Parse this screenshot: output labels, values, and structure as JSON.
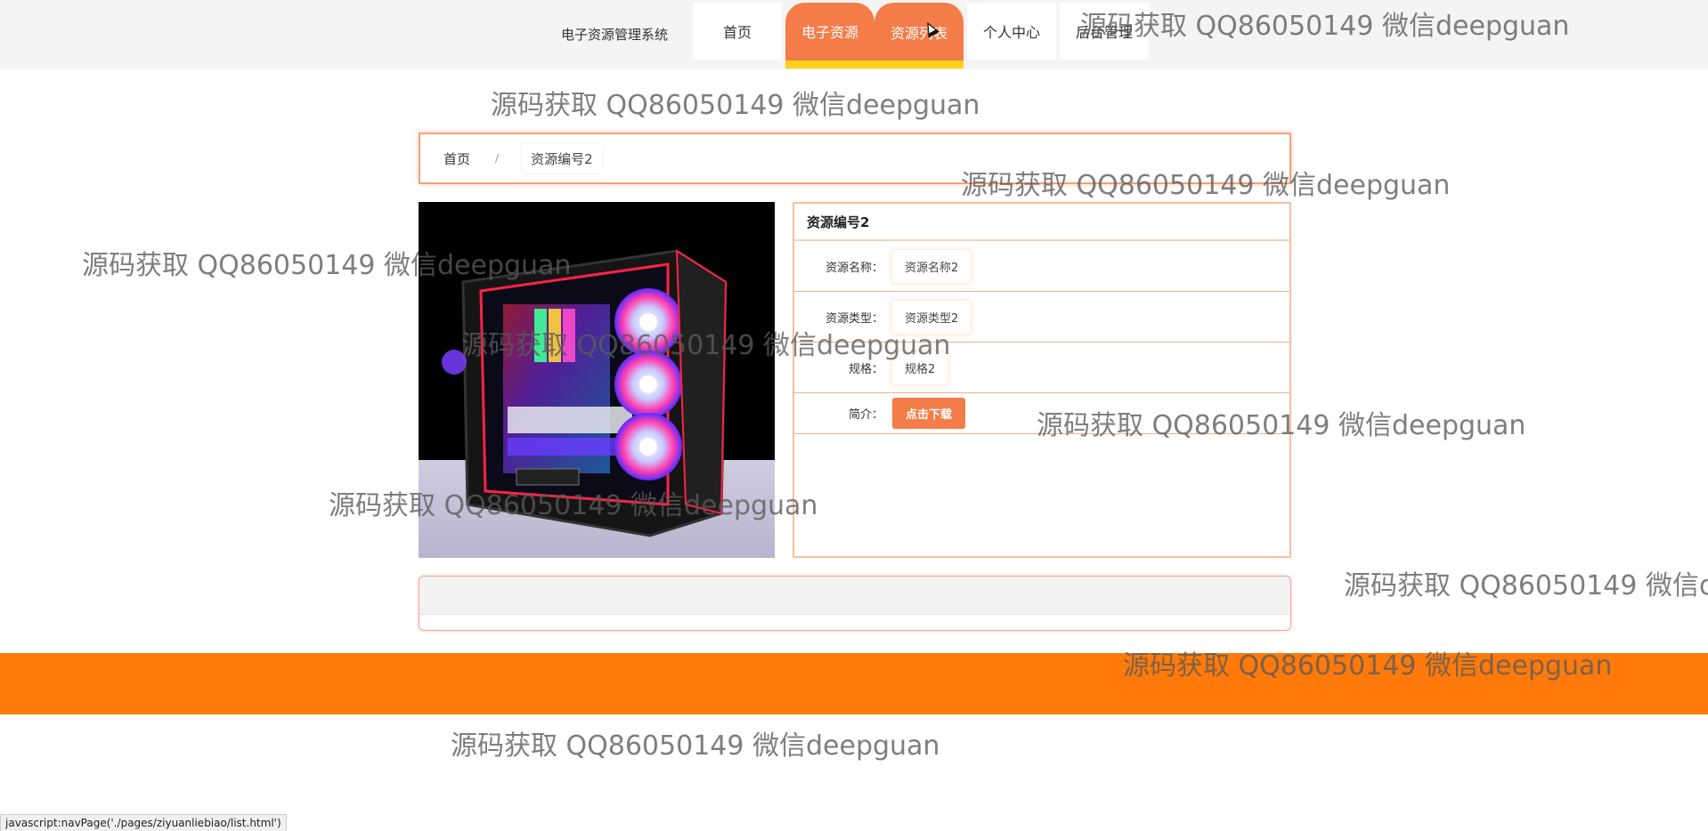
{
  "header": {
    "site_title": "电子资源管理系统",
    "nav": [
      {
        "label": "首页"
      },
      {
        "label": "电子资源"
      },
      {
        "label": "资源列表"
      },
      {
        "label": "个人中心"
      },
      {
        "label": "后台管理"
      }
    ]
  },
  "breadcrumb": {
    "home": "首页",
    "separator": "/",
    "current": "资源编号2"
  },
  "detail": {
    "title": "资源编号2",
    "fields": [
      {
        "label": "资源名称：",
        "value": "资源名称2"
      },
      {
        "label": "资源类型：",
        "value": "资源类型2"
      },
      {
        "label": "规格：",
        "value": "规格2"
      }
    ],
    "intro_label": "简介：",
    "download_label": "点击下载"
  },
  "watermark_text": "源码获取 QQ86050149 微信deepguan",
  "status_bar": {
    "url": "javascript:navPage('./pages/ziyuanliebiao/list.html')"
  },
  "colors": {
    "accent": "#f47c48",
    "footer": "#ff7a0a",
    "tab_underline": "#ffd21a"
  }
}
